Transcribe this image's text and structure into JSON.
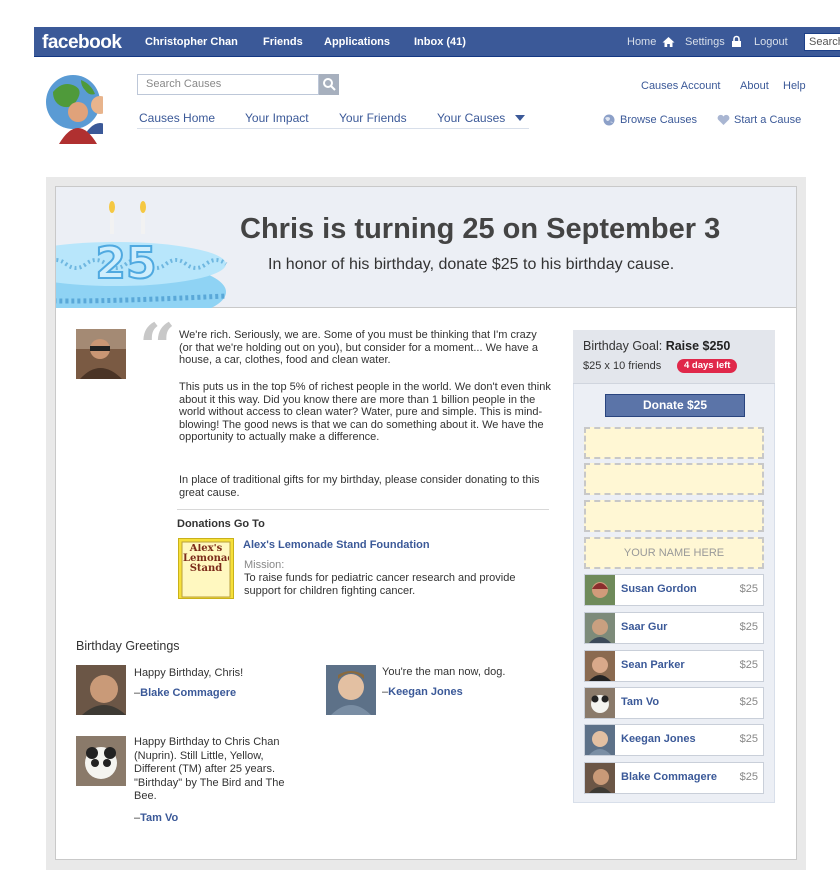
{
  "topbar": {
    "logo": "facebook",
    "nav": [
      "Christopher Chan",
      "Friends",
      "Applications",
      "Inbox (41)"
    ],
    "home": "Home",
    "settings": "Settings",
    "logout": "Logout",
    "search_placeholder": "Search"
  },
  "causes": {
    "search_placeholder": "Search Causes",
    "tabs": [
      "Causes Home",
      "Your Impact",
      "Your Friends",
      "Your Causes"
    ],
    "account": "Causes Account",
    "about": "About",
    "help": "Help",
    "browse": "Browse Causes",
    "start": "Start a Cause"
  },
  "banner": {
    "cake_number": "25",
    "title": "Chris is turning 25 on September 3",
    "subtitle": "In honor of his birthday, donate $25 to his birthday cause."
  },
  "story": {
    "p1": "We're rich. Seriously, we are. Some of you must be thinking that I'm crazy (or that we're holding out on you), but consider for a moment... We have a house, a car, clothes, food and clean water.",
    "p2": "This puts us in the top 5% of richest people in the world. We don't even think about it this way. Did you know there are more than 1 billion people in the world without access to clean water? Water, pure and simple. This is mind-blowing! The good news is that we can do something about it. We have the opportunity to actually make a difference.",
    "p3": "In place of traditional gifts for my birthday, please consider donating to this great cause.",
    "donations_heading": "Donations Go To",
    "org_logo_text": "Alex's Lemonade Stand",
    "org_name": "Alex's Lemonade Stand Foundation",
    "mission_label": "Mission:",
    "mission": "To raise funds for pediatric cancer research and provide support for children fighting cancer."
  },
  "greetings": {
    "heading": "Birthday Greetings",
    "items": [
      {
        "text": "Happy Birthday, Chris!",
        "author": "Blake Commagere"
      },
      {
        "text": "You're the man now, dog.",
        "author": "Keegan Jones"
      },
      {
        "text": "Happy Birthday to Chris Chan (Nuprin). Still Little, Yellow, Different (TM) after 25 years. \"Birthday\" by The Bird and The Bee.",
        "author": "Tam Vo"
      }
    ]
  },
  "goal": {
    "label": "Birthday Goal:",
    "amount": "Raise $250",
    "sub": "$25 x 10 friends",
    "badge": "4 days left",
    "donate": "Donate $25",
    "your_name": "YOUR NAME HERE",
    "donors": [
      {
        "name": "Susan Gordon",
        "amount": "$25"
      },
      {
        "name": "Saar Gur",
        "amount": "$25"
      },
      {
        "name": "Sean Parker",
        "amount": "$25"
      },
      {
        "name": "Tam Vo",
        "amount": "$25"
      },
      {
        "name": "Keegan Jones",
        "amount": "$25"
      },
      {
        "name": "Blake Commagere",
        "amount": "$25"
      }
    ]
  }
}
